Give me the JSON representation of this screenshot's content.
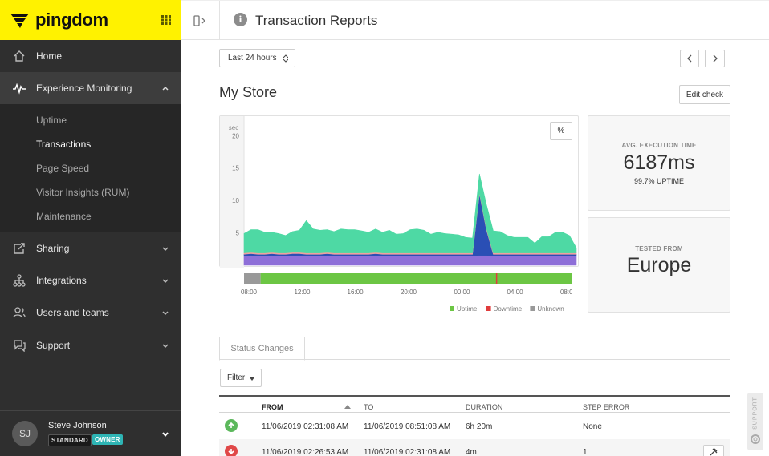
{
  "brand": {
    "name": "pingdom",
    "accent": "#fff200"
  },
  "sidebar": {
    "items": [
      {
        "label": "Home",
        "icon": "home-icon"
      },
      {
        "label": "Experience Monitoring",
        "icon": "pulse-icon",
        "expanded": true
      },
      {
        "label": "Sharing",
        "icon": "share-icon"
      },
      {
        "label": "Integrations",
        "icon": "integrations-icon"
      },
      {
        "label": "Users and teams",
        "icon": "users-icon"
      },
      {
        "label": "Support",
        "icon": "support-icon"
      }
    ],
    "subitems": [
      {
        "label": "Uptime"
      },
      {
        "label": "Transactions",
        "current": true
      },
      {
        "label": "Page Speed"
      },
      {
        "label": "Visitor Insights (RUM)"
      },
      {
        "label": "Maintenance"
      }
    ],
    "user": {
      "initials": "SJ",
      "name": "Steve Johnson",
      "plan": "STANDARD",
      "role": "OWNER"
    }
  },
  "header": {
    "title": "Transaction Reports"
  },
  "toolbar": {
    "range": "Last 24 hours"
  },
  "check": {
    "name": "My Store",
    "edit_label": "Edit check",
    "percent_label": "%"
  },
  "chart_data": {
    "type": "area",
    "ylabel": "sec",
    "yticks": [
      5,
      10,
      15,
      20
    ],
    "ylim": [
      0,
      23
    ],
    "x_ticks": [
      "08:00",
      "12:00",
      "16:00",
      "20:00",
      "00:00",
      "04:00",
      "08:00"
    ],
    "series": [
      {
        "color": "#8e6fd8",
        "values": [
          1.4,
          1.5,
          1.4,
          1.4,
          1.5,
          1.4,
          1.4,
          1.5,
          1.5,
          1.4,
          1.4,
          1.4,
          1.5,
          1.4,
          1.4,
          1.4,
          1.4,
          1.4,
          1.4,
          1.5,
          1.4,
          1.4,
          1.4,
          1.4,
          1.4,
          1.4,
          1.4,
          1.4,
          1.4,
          1.4,
          1.4,
          1.4,
          1.4,
          1.4,
          1.5,
          1.5,
          1.4,
          1.4,
          1.4,
          1.4,
          1.4,
          1.4,
          1.4,
          1.4,
          1.4,
          1.4,
          1.4,
          1.4,
          1.4
        ]
      },
      {
        "color": "#2a4fb5",
        "values": [
          0.3,
          0.3,
          0.3,
          0.3,
          0.3,
          0.3,
          0.3,
          0.3,
          0.3,
          0.3,
          0.3,
          0.3,
          0.3,
          0.3,
          0.3,
          0.3,
          0.3,
          0.3,
          0.3,
          0.3,
          0.3,
          0.3,
          0.3,
          0.3,
          0.3,
          0.3,
          0.3,
          0.3,
          0.3,
          0.3,
          0.3,
          0.3,
          0.3,
          0.3,
          9.5,
          4.0,
          0.3,
          0.3,
          0.3,
          0.3,
          0.3,
          0.3,
          0.3,
          0.3,
          0.3,
          0.3,
          0.3,
          0.3,
          0.3
        ]
      },
      {
        "color": "#f0a0a0",
        "values": [
          0.2,
          0.2,
          0.2,
          0.2,
          0.2,
          0.2,
          0.2,
          0.2,
          0.2,
          0.2,
          0.2,
          0.2,
          0.2,
          0.2,
          0.2,
          0.2,
          0.2,
          0.2,
          0.2,
          0.2,
          0.2,
          0.2,
          0.2,
          0.2,
          0.2,
          0.2,
          0.2,
          0.2,
          0.2,
          0.2,
          0.2,
          0.2,
          0.2,
          0.2,
          0.2,
          0.2,
          0.2,
          0.2,
          0.2,
          0.2,
          0.2,
          0.2,
          0.2,
          0.2,
          0.2,
          0.2,
          0.2,
          0.2,
          0.2
        ]
      },
      {
        "color": "#4ed9a4",
        "values": [
          3.0,
          3.5,
          3.6,
          3.2,
          3.1,
          3.0,
          2.7,
          3.2,
          3.4,
          5.0,
          3.7,
          3.5,
          3.5,
          3.3,
          3.7,
          3.6,
          3.6,
          3.4,
          3.2,
          3.6,
          3.2,
          3.5,
          2.9,
          3.0,
          3.6,
          3.7,
          3.5,
          2.9,
          3.2,
          3.0,
          2.9,
          2.8,
          2.4,
          2.3,
          2.9,
          3.7,
          3.4,
          3.3,
          2.7,
          2.4,
          2.4,
          2.4,
          1.5,
          2.5,
          2.5,
          3.2,
          3.2,
          2.7,
          0.8
        ]
      }
    ],
    "status_bar": {
      "unknown": [
        0,
        0.05
      ],
      "uptime": [
        0.05,
        1.0
      ],
      "downtime_at": 0.76
    },
    "legend": [
      "Uptime",
      "Downtime",
      "Unknown"
    ],
    "legend_colors": [
      "#6cc644",
      "#e03c3c",
      "#999999"
    ]
  },
  "stats": {
    "avg_label": "AVG. EXECUTION TIME",
    "avg_value": "6187ms",
    "uptime": "99.7% UPTIME",
    "tested_label": "TESTED FROM",
    "tested_value": "Europe"
  },
  "status_changes": {
    "tab": "Status Changes",
    "filter": "Filter",
    "columns": [
      "FROM",
      "TO",
      "DURATION",
      "STEP ERROR"
    ],
    "rows": [
      {
        "status": "up",
        "from": "11/06/2019 02:31:08 AM",
        "to": "11/06/2019 08:51:08 AM",
        "duration": "6h 20m",
        "error": "None"
      },
      {
        "status": "down",
        "from": "11/06/2019 02:26:53 AM",
        "to": "11/06/2019 02:31:08 AM",
        "duration": "4m",
        "error": "1"
      }
    ]
  },
  "support_tab": "SUPPORT"
}
